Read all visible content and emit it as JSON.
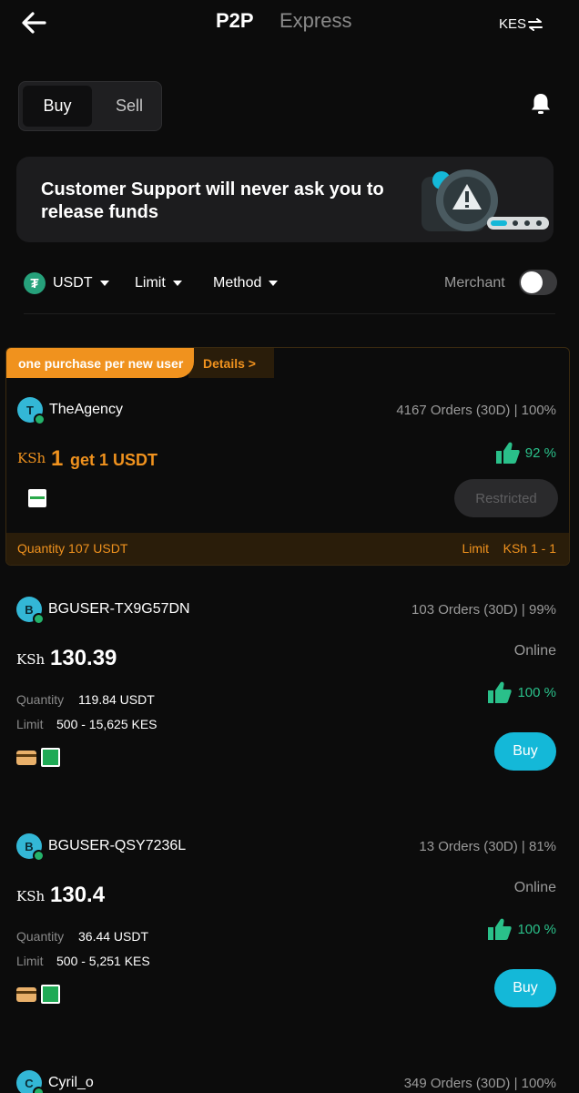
{
  "header": {
    "tabs": [
      "P2P",
      "Express"
    ],
    "currency": "KES"
  },
  "trade_toggle": {
    "buy": "Buy",
    "sell": "Sell"
  },
  "banner": {
    "text": "Customer Support will never ask you to release funds"
  },
  "filters": {
    "coin": "USDT",
    "limit": "Limit",
    "method": "Method",
    "merchant": "Merchant"
  },
  "promo": {
    "tag": "one purchase per new user",
    "details": "Details >",
    "avatar_initial": "T",
    "user": "TheAgency",
    "orders": "4167 Orders (30D) | 100%",
    "currency_symbol": "KSh",
    "amount": "1",
    "offer": "get 1 USDT",
    "rating": "92 %",
    "action": "Restricted",
    "quantity": "Quantity 107 USDT",
    "limit_label": "Limit",
    "limit_value": "KSh 1 - 1"
  },
  "listings": [
    {
      "avatar_initial": "B",
      "user": "BGUSER-TX9G57DN",
      "orders": "103 Orders (30D) | 99%",
      "currency_symbol": "KSh",
      "price": "130.39",
      "status": "Online",
      "quantity_label": "Quantity",
      "quantity": "119.84 USDT",
      "limit_label": "Limit",
      "limit": "500 - 15,625 KES",
      "rating": "100 %",
      "action": "Buy"
    },
    {
      "avatar_initial": "B",
      "user": "BGUSER-QSY7236L",
      "orders": "13 Orders (30D) | 81%",
      "currency_symbol": "KSh",
      "price": "130.4",
      "status": "Online",
      "quantity_label": "Quantity",
      "quantity": "36.44 USDT",
      "limit_label": "Limit",
      "limit": "500 - 5,251 KES",
      "rating": "100 %",
      "action": "Buy"
    },
    {
      "avatar_initial": "C",
      "user": "Cyril_o",
      "orders": "349 Orders (30D) | 100%"
    }
  ],
  "colors": {
    "accent": "#14b8d8",
    "promo": "#f0921e",
    "positive": "#2ac08a",
    "background": "#0c0c0c"
  }
}
